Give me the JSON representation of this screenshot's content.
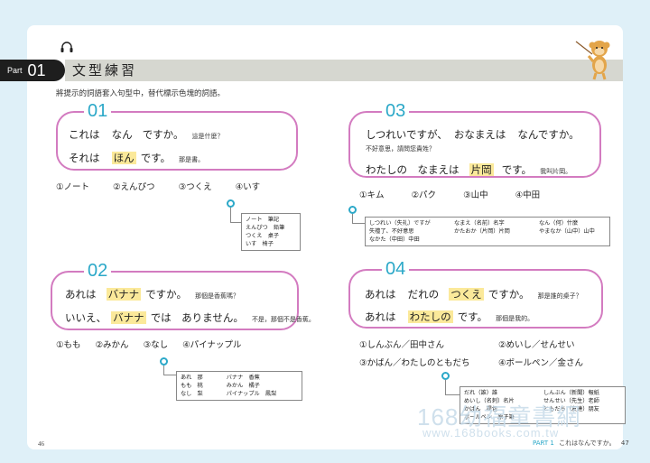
{
  "header": {
    "part_label": "Part",
    "part_number": "01",
    "title": "文型練習"
  },
  "instruction": "將提示的詞語套入句型中，替代標示色塊的詞語。",
  "exercises": [
    {
      "number": "01",
      "line1": {
        "a": "これは",
        "b": "なん",
        "c": "ですか。",
        "trans": "這是什麼？"
      },
      "line2": {
        "a": "それは",
        "hl": "ほん",
        "c": "です。",
        "trans": "那是書。"
      },
      "options": [
        "①ノート",
        "②えんぴつ",
        "③つくえ",
        "④いす"
      ],
      "vocab": [
        [
          "ノート　筆記",
          "えんぴつ　鉛筆",
          "つくえ　桌子",
          "いす　椅子"
        ]
      ]
    },
    {
      "number": "02",
      "line1": {
        "a": "あれは",
        "hl": "バナナ",
        "c": "ですか。",
        "trans": "那個是香蕉嗎？"
      },
      "line2": {
        "a": "いいえ、",
        "hl": "バナナ",
        "c": "では　ありません。",
        "trans": "不是，那個不是香蕉。"
      },
      "options": [
        "①もも",
        "②みかん",
        "③なし",
        "④パイナップル"
      ],
      "vocab": [
        [
          "あれ　那",
          "もも　桃",
          "なし　梨"
        ],
        [
          "バナナ　香蕉",
          "みかん　橘子",
          "パイナップル　鳳梨"
        ]
      ]
    },
    {
      "number": "03",
      "line1": {
        "a": "しつれいですが、",
        "b": "おなまえは",
        "c": "なんですか。",
        "trans": "不好意思，請問您貴姓？"
      },
      "line2": {
        "a": "わたしの　なまえは",
        "hl": "片岡",
        "c": "です。",
        "trans": "我叫片岡。"
      },
      "options": [
        "①キム",
        "②パク",
        "③山中",
        "④中田"
      ],
      "vocab": [
        [
          "しつれい（失礼）ですが",
          "失禮了、不好意思",
          "なかた（中田）中田"
        ],
        [
          "なまえ（名前）名字",
          "かたおか（片岡）片岡"
        ],
        [
          "なん（何）什麼",
          "やまなか（山中）山中"
        ]
      ]
    },
    {
      "number": "04",
      "line1": {
        "a": "あれは",
        "b": "だれの",
        "hl": "つくえ",
        "c": "ですか。",
        "trans": "那是誰的桌子？"
      },
      "line2": {
        "a": "あれは",
        "hl": "わたしの",
        "c": "です。",
        "trans": "那個是我的。"
      },
      "options": [
        "①しんぶん／田中さん",
        "②めいし／せんせい",
        "③かばん／わたしのともだち",
        "④ボールペン／金さん"
      ],
      "vocab": [
        [
          "だれ（誰）誰",
          "めいし（名刺）名片",
          "かばん　提包",
          "ボールペン　原子筆"
        ],
        [
          "しんぶん（新聞）報紙",
          "せんせい（先生）老師",
          "ともだち（友達）朋友"
        ]
      ]
    }
  ],
  "footer": {
    "page_left": "46",
    "part_ref": "PART 1",
    "chapter": "これはなんですか。",
    "page_right": "47"
  },
  "watermark": {
    "text": "168幼福童書網",
    "url": "www.168books.com.tw"
  },
  "colors": {
    "accent_blue": "#2ba8c8",
    "box_border": "#d37bc0",
    "highlight": "#fbe99a",
    "title_bar": "#d6d7d0"
  }
}
